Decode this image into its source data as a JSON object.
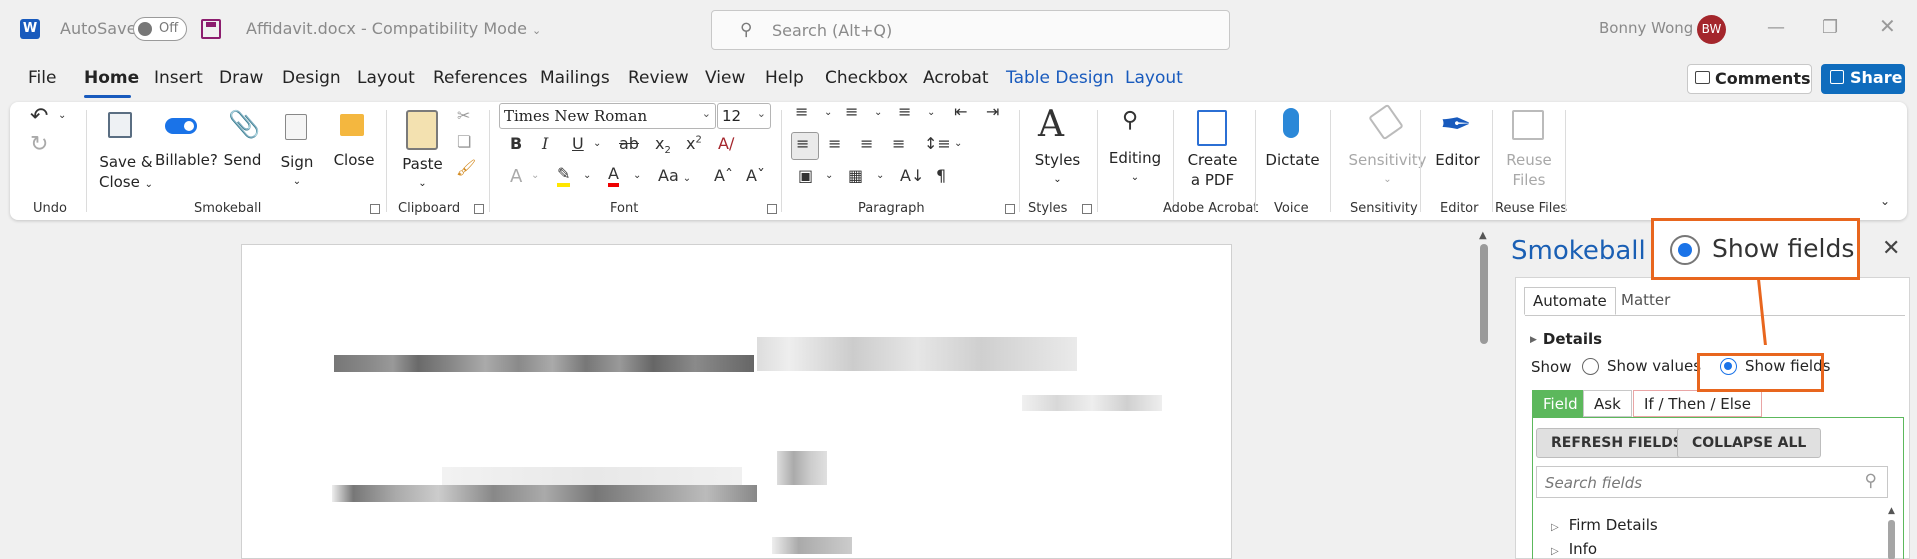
{
  "titlebar": {
    "app_logo": "W",
    "autosave_label": "AutoSave",
    "autosave_state": "Off",
    "doc_title": "Affidavit.docx  -  Compatibility Mode",
    "search_placeholder": "Search (Alt+Q)",
    "user_name": "Bonny Wong",
    "user_initials": "BW"
  },
  "tabs": [
    "File",
    "Home",
    "Insert",
    "Draw",
    "Design",
    "Layout",
    "References",
    "Mailings",
    "Review",
    "View",
    "Help",
    "Checkbox",
    "Acrobat",
    "Table Design",
    "Layout"
  ],
  "active_tab": "Home",
  "comments_label": "Comments",
  "share_label": "Share",
  "ribbon": {
    "undo_group": "Undo",
    "smokeball": {
      "save_close": "Save &",
      "save_close2": "Close",
      "billable": "Billable?",
      "send": "Send",
      "sign": "Sign",
      "close": "Close",
      "group": "Smokeball"
    },
    "clipboard": {
      "paste": "Paste",
      "group": "Clipboard"
    },
    "font": {
      "name": "Times New Roman",
      "size": "12",
      "group": "Font",
      "aa": "Aa"
    },
    "paragraph_group": "Paragraph",
    "styles": {
      "label": "Styles",
      "group": "Styles"
    },
    "editing": {
      "label": "Editing"
    },
    "acrobat": {
      "label1": "Create",
      "label2": "a PDF",
      "group": "Adobe Acrobat"
    },
    "voice": {
      "label": "Dictate",
      "group": "Voice"
    },
    "sensitivity": {
      "label": "Sensitivity",
      "group": "Sensitivity"
    },
    "editor": {
      "label": "Editor",
      "group": "Editor"
    },
    "reuse": {
      "label1": "Reuse",
      "label2": "Files",
      "group": "Reuse Files"
    }
  },
  "pane": {
    "title": "Smokeball",
    "tabs": [
      "Automate",
      "Matter"
    ],
    "details": "Details",
    "show_label": "Show",
    "show_values": "Show values",
    "show_fields": "Show fields",
    "selected": "Show fields",
    "field_tabs": [
      "Field",
      "Ask",
      "If / Then / Else"
    ],
    "refresh_btn": "REFRESH FIELDS",
    "collapse_btn": "COLLAPSE ALL",
    "search_placeholder": "Search fields",
    "tree": [
      "Firm Details",
      "Info"
    ]
  },
  "callout": {
    "label": "Show fields"
  },
  "colors": {
    "accent": "#185abd",
    "callout": "#e8661e",
    "field_tab": "#5cb85c",
    "pane_title": "#1a5fb4"
  }
}
